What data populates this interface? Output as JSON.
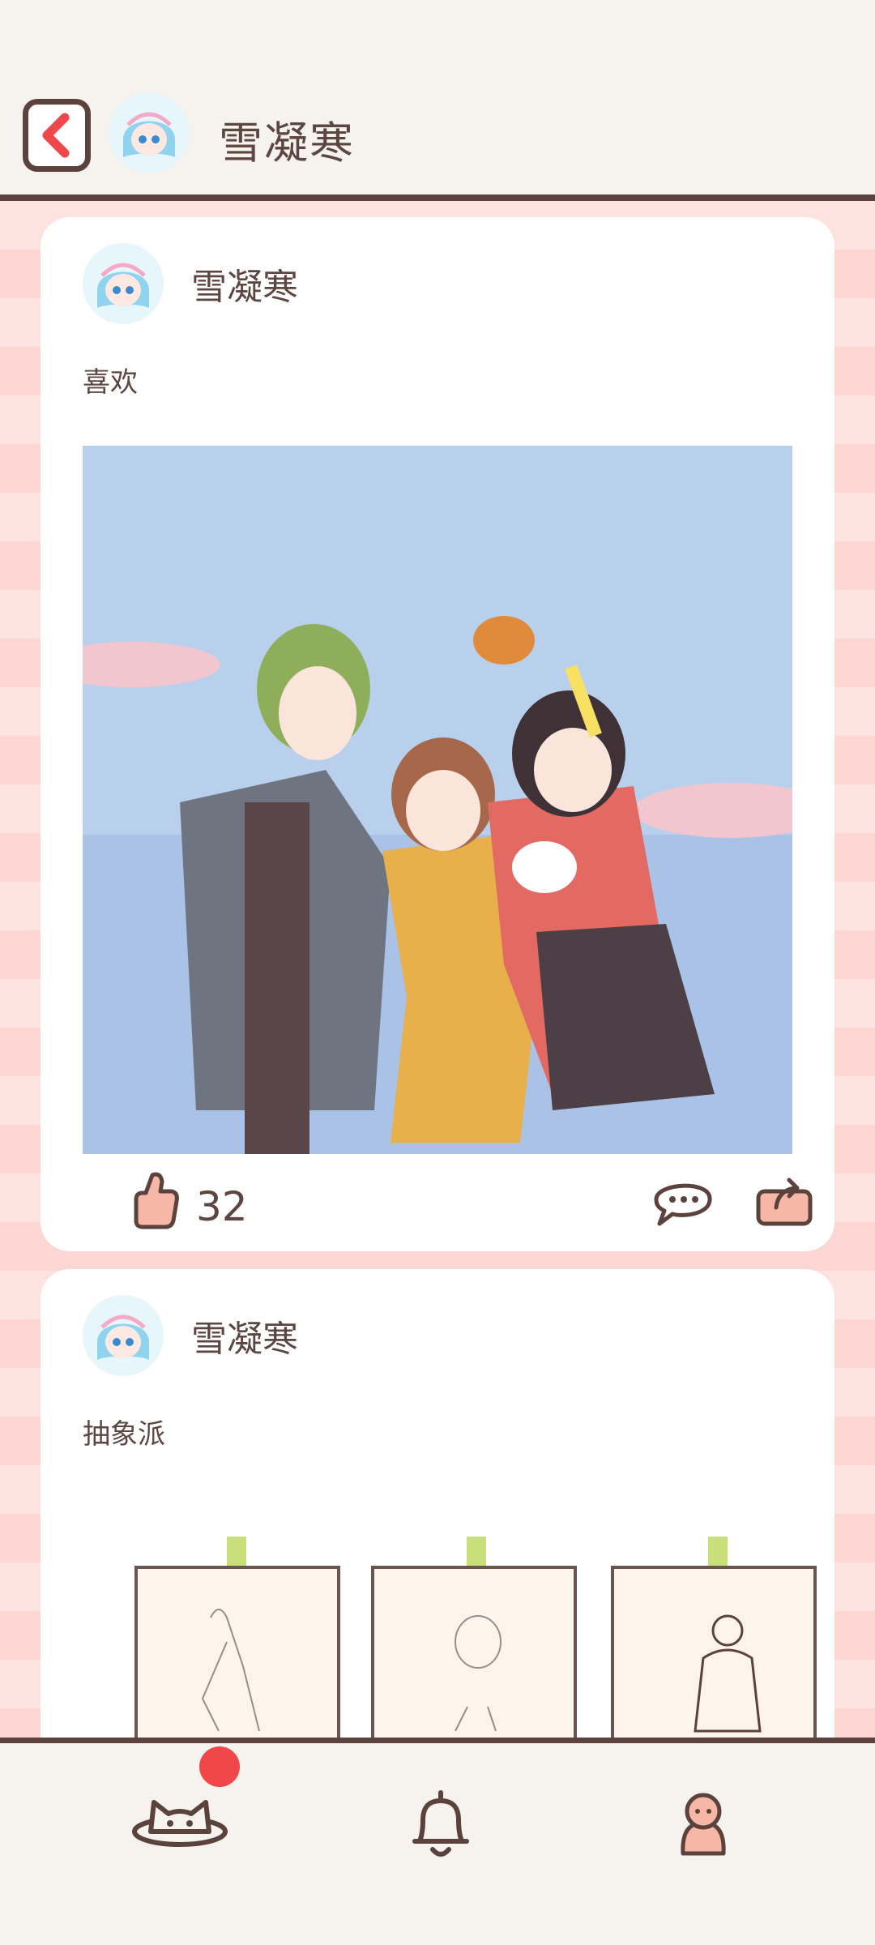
{
  "header": {
    "title": "雪凝寒"
  },
  "posts": [
    {
      "author": "雪凝寒",
      "text": "喜欢",
      "likes": "32"
    },
    {
      "author": "雪凝寒",
      "text": "抽象派"
    }
  ],
  "nav": {
    "items": [
      "home-icon",
      "bell-icon",
      "profile-icon"
    ],
    "badge_color": "#f0474a"
  },
  "colors": {
    "accent": "#f0474a",
    "outline": "#5b423c",
    "like": "#f7b7a7"
  }
}
